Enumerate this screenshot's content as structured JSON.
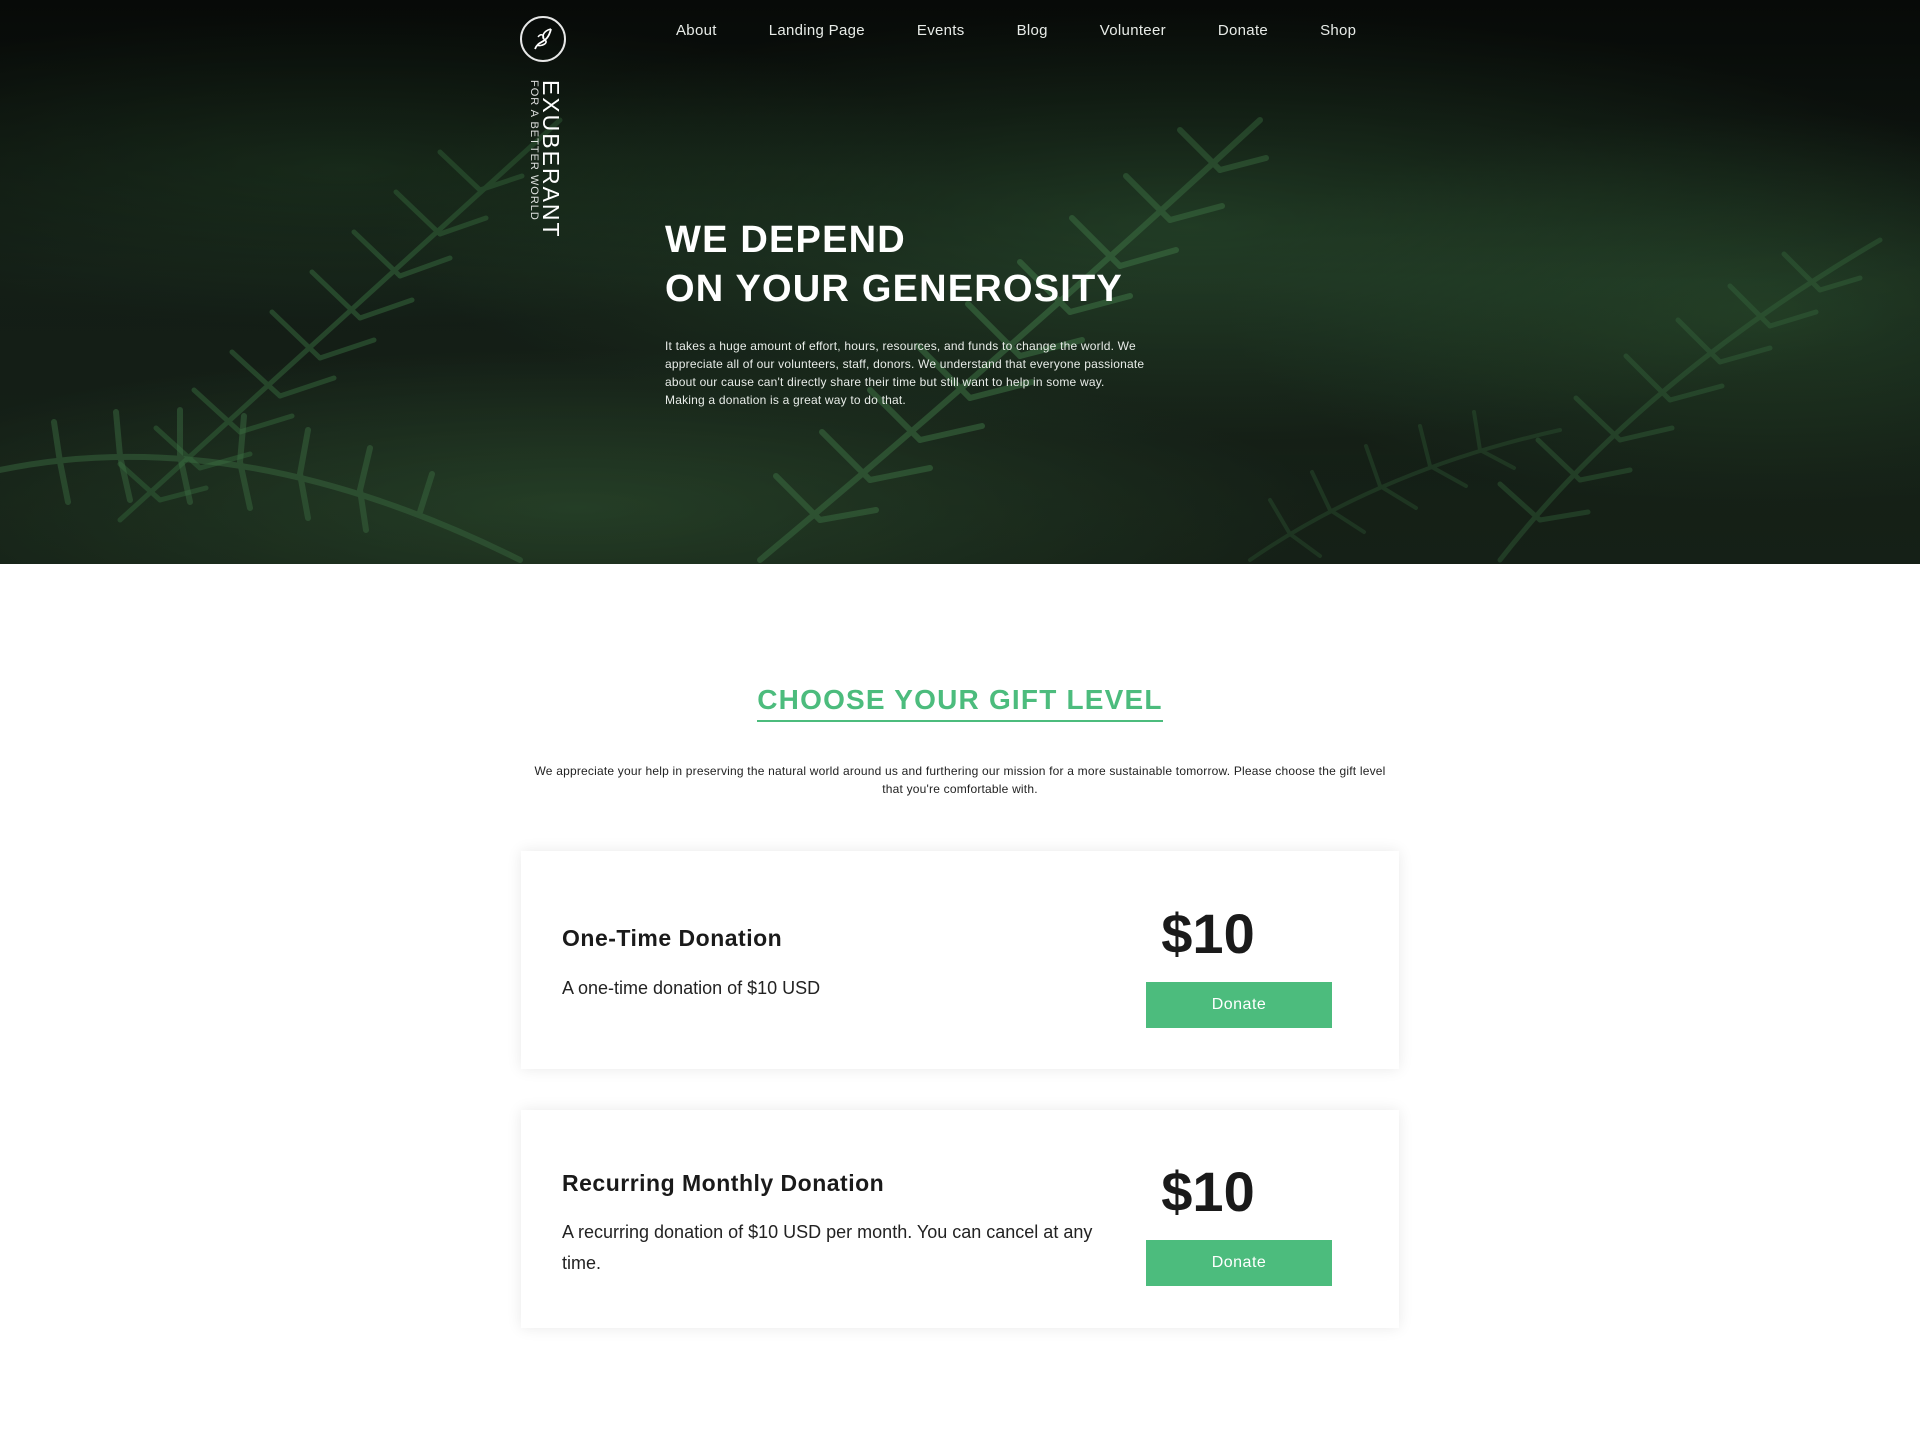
{
  "brand": {
    "name": "EXUBERANT",
    "tagline": "FOR A BETTER WORLD",
    "logo_icon": "leaf-swirl-icon"
  },
  "nav": {
    "items": [
      {
        "label": "About"
      },
      {
        "label": "Landing Page"
      },
      {
        "label": "Events"
      },
      {
        "label": "Blog"
      },
      {
        "label": "Volunteer"
      },
      {
        "label": "Donate"
      },
      {
        "label": "Shop"
      }
    ]
  },
  "hero": {
    "title_line1": "WE DEPEND",
    "title_line2": "ON YOUR GENEROSITY",
    "text": "It takes a huge amount of effort, hours, resources, and funds to change the world. We appreciate all of our volunteers, staff, donors. We understand that everyone passionate about our cause can't directly share their time but still want to help in some way. Making a donation is a great way to do that."
  },
  "gifts": {
    "title": "CHOOSE YOUR GIFT LEVEL",
    "intro": "We appreciate your help in preserving the natural world around us and furthering our mission for a more sustainable tomorrow. Please choose the gift level that you're comfortable with.",
    "cards": [
      {
        "name": "One-Time Donation",
        "description": "A one-time donation of $10 USD",
        "price": "$10",
        "button_label": "Donate"
      },
      {
        "name": "Recurring Monthly Donation",
        "description": "A recurring donation of $10 USD per month. You can cancel at any time.",
        "price": "$10",
        "button_label": "Donate"
      }
    ]
  },
  "colors": {
    "accent": "#4cbc7d",
    "hero_dark": "#111a13",
    "text_dark": "#1a1a1a"
  }
}
